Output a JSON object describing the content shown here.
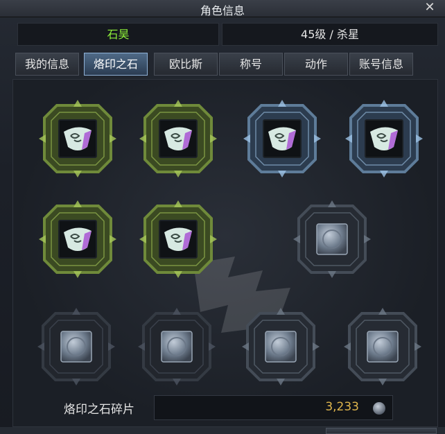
{
  "window": {
    "title": "角色信息",
    "close_icon": "close-icon"
  },
  "character": {
    "name": "石昊",
    "level_class": "45级 / 杀星"
  },
  "tabs": [
    {
      "label": "我的信息",
      "active": false
    },
    {
      "label": "烙印之石",
      "active": true
    },
    {
      "label": "欧比斯",
      "active": false
    },
    {
      "label": "称号",
      "active": false
    },
    {
      "label": "动作",
      "active": false
    },
    {
      "label": "账号信息",
      "active": false
    }
  ],
  "slots": [
    {
      "frame": "green",
      "stone": "branded-stone"
    },
    {
      "frame": "green",
      "stone": "branded-stone"
    },
    {
      "frame": "blue",
      "stone": "branded-stone"
    },
    {
      "frame": "blue",
      "stone": "branded-stone"
    },
    {
      "frame": "green",
      "stone": "branded-stone"
    },
    {
      "frame": "green",
      "stone": "branded-stone"
    },
    {
      "frame": "dark",
      "stone": "empty"
    },
    {
      "frame": "dark-dim",
      "stone": "empty"
    },
    {
      "frame": "dark-dim",
      "stone": "empty"
    },
    {
      "frame": "dark",
      "stone": "empty"
    },
    {
      "frame": "dark",
      "stone": "empty"
    }
  ],
  "fragments": {
    "label": "烙印之石碎片",
    "value": "3,233",
    "icon": "coin-icon"
  },
  "colors": {
    "name": "#8ff23a",
    "value": "#e0b64d",
    "active_tab": "#4f6a87"
  }
}
